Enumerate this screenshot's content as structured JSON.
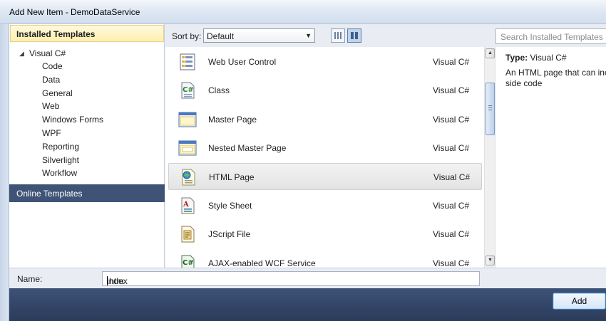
{
  "window": {
    "title": "Add New Item - DemoDataService"
  },
  "left_panel": {
    "installed_header": "Installed Templates",
    "root": "Visual C#",
    "items": [
      "Code",
      "Data",
      "General",
      "Web",
      "Windows Forms",
      "WPF",
      "Reporting",
      "Silverlight",
      "Workflow"
    ],
    "online_header": "Online Templates"
  },
  "toolbar": {
    "sort_label": "Sort by:",
    "sort_value": "Default"
  },
  "templates": [
    {
      "name": "Web User Control",
      "lang": "Visual C#",
      "icon": "web-user-control-icon"
    },
    {
      "name": "Class",
      "lang": "Visual C#",
      "icon": "class-file-icon"
    },
    {
      "name": "Master Page",
      "lang": "Visual C#",
      "icon": "master-page-icon"
    },
    {
      "name": "Nested Master Page",
      "lang": "Visual C#",
      "icon": "nested-master-page-icon"
    },
    {
      "name": "HTML Page",
      "lang": "Visual C#",
      "icon": "html-page-icon",
      "selected": true
    },
    {
      "name": "Style Sheet",
      "lang": "Visual C#",
      "icon": "style-sheet-icon"
    },
    {
      "name": "JScript File",
      "lang": "Visual C#",
      "icon": "jscript-file-icon"
    },
    {
      "name": "AJAX-enabled WCF Service",
      "lang": "Visual C#",
      "icon": "wcf-service-icon"
    }
  ],
  "search": {
    "placeholder": "Search Installed Templates"
  },
  "details": {
    "type_label": "Type:",
    "type_value": "Visual C#",
    "desc_line1": "An HTML page that can inc",
    "desc_line2": "side code"
  },
  "name_field": {
    "label": "Name:",
    "value_before_caret": "index",
    "value_after_caret": ".htm"
  },
  "buttons": {
    "add": "Add"
  },
  "colors": {
    "online_header_bg": "#3f5376",
    "bottom_bar_bg": "#2b3b5a",
    "installed_header_bg": "#ffefb0"
  }
}
